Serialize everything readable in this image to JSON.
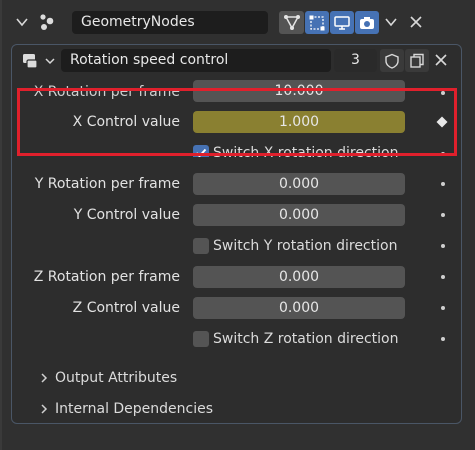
{
  "header": {
    "modifier_name": "GeometryNodes",
    "icons": [
      "collapse-chevron-icon",
      "geometry-nodes-icon",
      "node-tree-icon",
      "edit-mode-icon",
      "viewport-display-icon",
      "render-icon",
      "dropdown-chevron-icon",
      "close-icon"
    ]
  },
  "node_group": {
    "name": "Rotation speed control",
    "user_count": "3",
    "icons": [
      "node-tree-selector-icon",
      "fake-user-shield-icon",
      "duplicate-icon",
      "unlink-icon"
    ]
  },
  "properties": [
    {
      "label": "X Rotation per frame",
      "value": "10.000",
      "highlighted": false
    },
    {
      "label": "X Control value",
      "value": "1.000",
      "highlighted": true
    },
    {
      "label": "Y Rotation per frame",
      "value": "0.000",
      "highlighted": false
    },
    {
      "label": "Y Control value",
      "value": "0.000",
      "highlighted": false
    },
    {
      "label": "Z Rotation per frame",
      "value": "0.000",
      "highlighted": false
    },
    {
      "label": "Z Control value",
      "value": "0.000",
      "highlighted": false
    }
  ],
  "checkboxes": [
    {
      "label": "Switch X rotation direction",
      "checked": true
    },
    {
      "label": "Switch Y rotation direction",
      "checked": false
    },
    {
      "label": "Switch Z rotation direction",
      "checked": false
    }
  ],
  "sections": [
    {
      "label": "Output Attributes"
    },
    {
      "label": "Internal Dependencies"
    }
  ],
  "colors": {
    "background": "#303030",
    "field": "#545454",
    "highlighted_field": "#8a8031",
    "accent_blue": "#4672b4",
    "annotation_red": "#e0202c"
  }
}
